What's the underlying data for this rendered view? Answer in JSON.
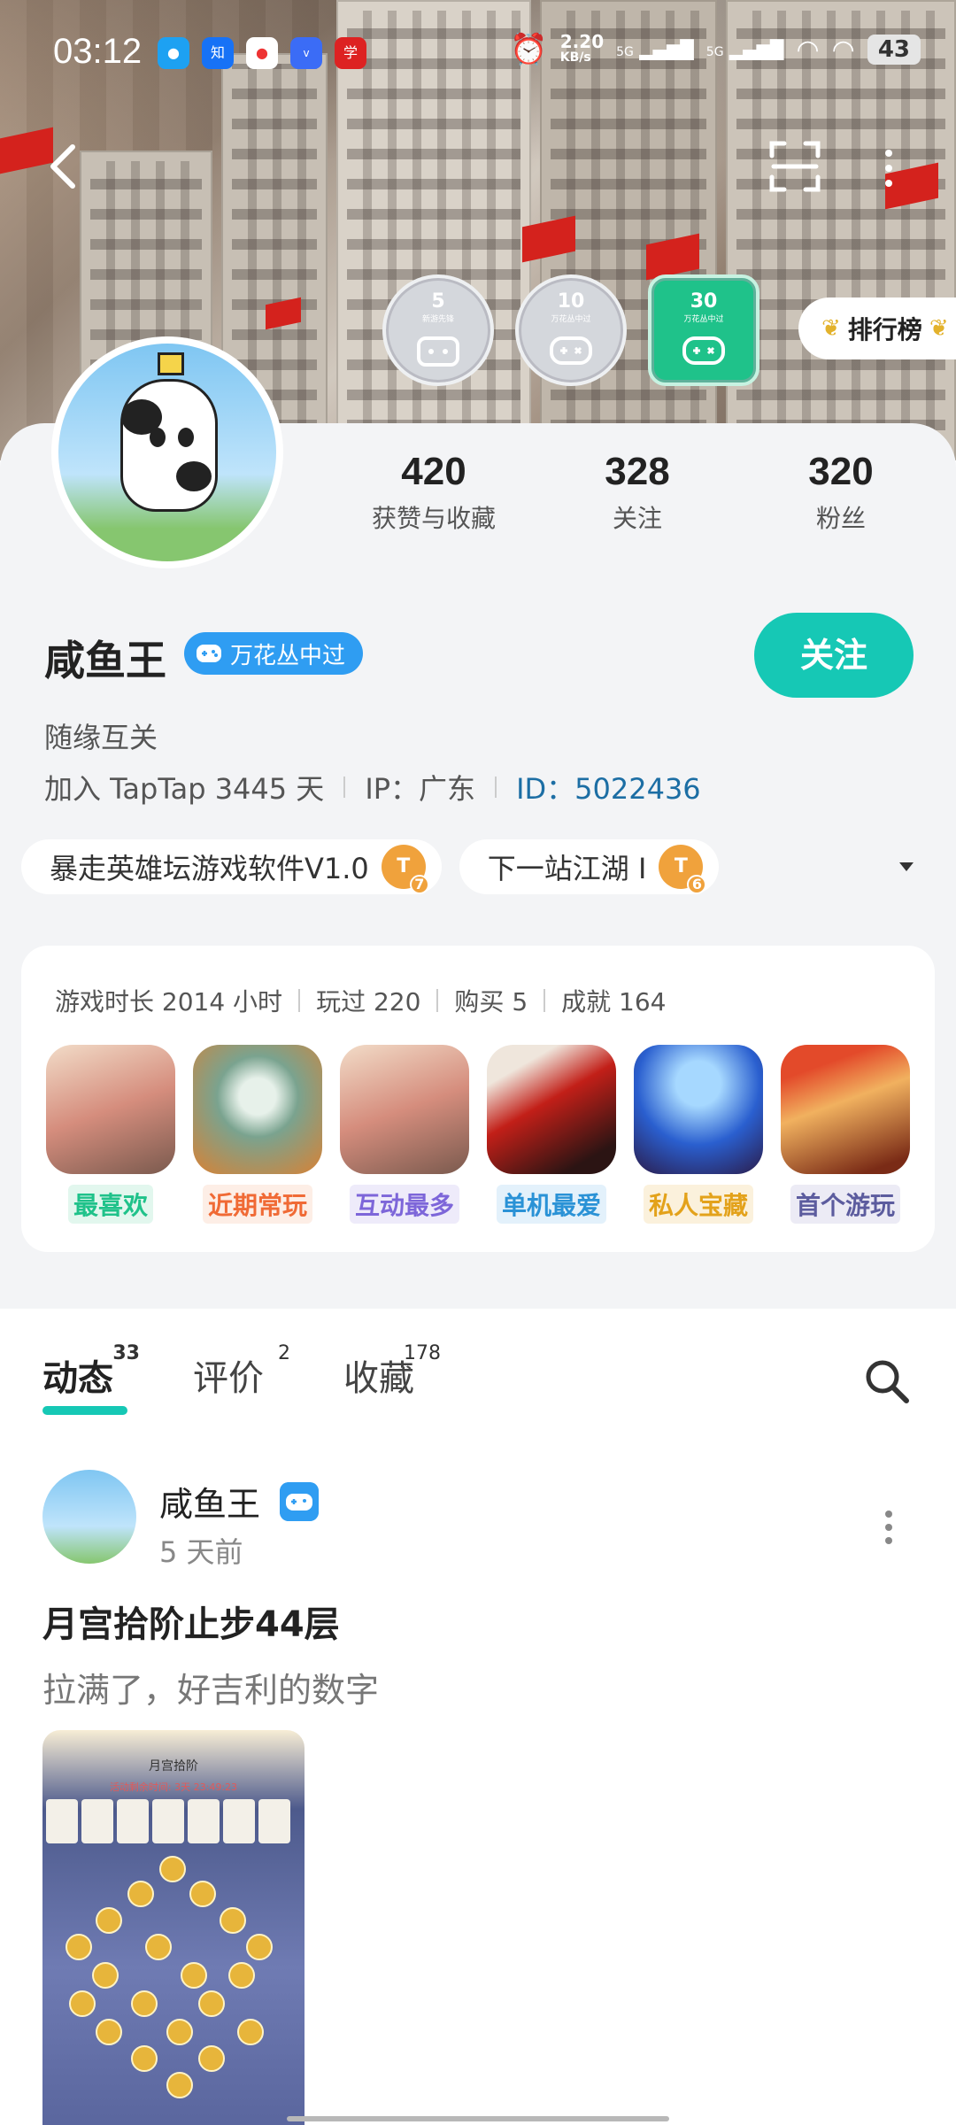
{
  "status_bar": {
    "time": "03:12",
    "net_speed": "2.20",
    "net_unit": "KB/s",
    "signal1": "5G",
    "signal2": "5G",
    "battery": "43",
    "app_icons": [
      "qq-icon",
      "zhihu-icon",
      "maps-icon",
      "vivo-icon",
      "xuexi-icon"
    ]
  },
  "header": {
    "back_icon": "chevron-left-icon",
    "scan_icon": "scan-icon",
    "more_icon": "more-vertical-icon"
  },
  "badges": [
    {
      "num": "5",
      "sub": "新游先锋",
      "icon": "calendar-gamepad-icon"
    },
    {
      "num": "10",
      "sub": "万花丛中过",
      "icon": "gamepad-icon"
    },
    {
      "num": "30",
      "sub": "万花丛中过",
      "icon": "gamepad-icon"
    }
  ],
  "rank_label": "排行榜",
  "stats": [
    {
      "value": "420",
      "label": "获赞与收藏"
    },
    {
      "value": "328",
      "label": "关注"
    },
    {
      "value": "320",
      "label": "粉丝"
    }
  ],
  "profile": {
    "name": "咸鱼王",
    "tag": "万花丛中过",
    "follow_label": "关注",
    "bio": "随缘互关",
    "joined": "加入 TapTap 3445 天",
    "ip": "IP：广东",
    "id": "ID：5022436"
  },
  "chips": [
    {
      "label": "暴走英雄坛游戏软件V1.0",
      "level": "T",
      "level_num": "7"
    },
    {
      "label": "下一站江湖 Ⅰ",
      "level": "T",
      "level_num": "6"
    }
  ],
  "games": {
    "playtime": "游戏时长 2014 小时",
    "played": "玩过 220",
    "bought": "购买 5",
    "achievements": "成就 164",
    "items": [
      {
        "label": "最喜欢",
        "color": "#1fc28a",
        "bg": "#e2f7ee"
      },
      {
        "label": "近期常玩",
        "color": "#f06a35",
        "bg": "#fdeee6"
      },
      {
        "label": "互动最多",
        "color": "#7d66d9",
        "bg": "#eeebfa"
      },
      {
        "label": "单机最爱",
        "color": "#2a92d6",
        "bg": "#e3f1fb"
      },
      {
        "label": "私人宝藏",
        "color": "#e3a21b",
        "bg": "#fbf1dc"
      },
      {
        "label": "首个游玩",
        "color": "#5c5c9e",
        "bg": "#ecebf5"
      }
    ]
  },
  "tabs": [
    {
      "label": "动态",
      "count": "33"
    },
    {
      "label": "评价",
      "count": "2"
    },
    {
      "label": "收藏",
      "count": "178"
    }
  ],
  "post": {
    "author": "咸鱼王",
    "time": "5 天前",
    "title": "月宫拾阶止步44层",
    "text": "拉满了，好吉利的数字",
    "image_title": "月宫拾阶",
    "image_sub": "活动剩余时间: 3天 23:49:23"
  }
}
